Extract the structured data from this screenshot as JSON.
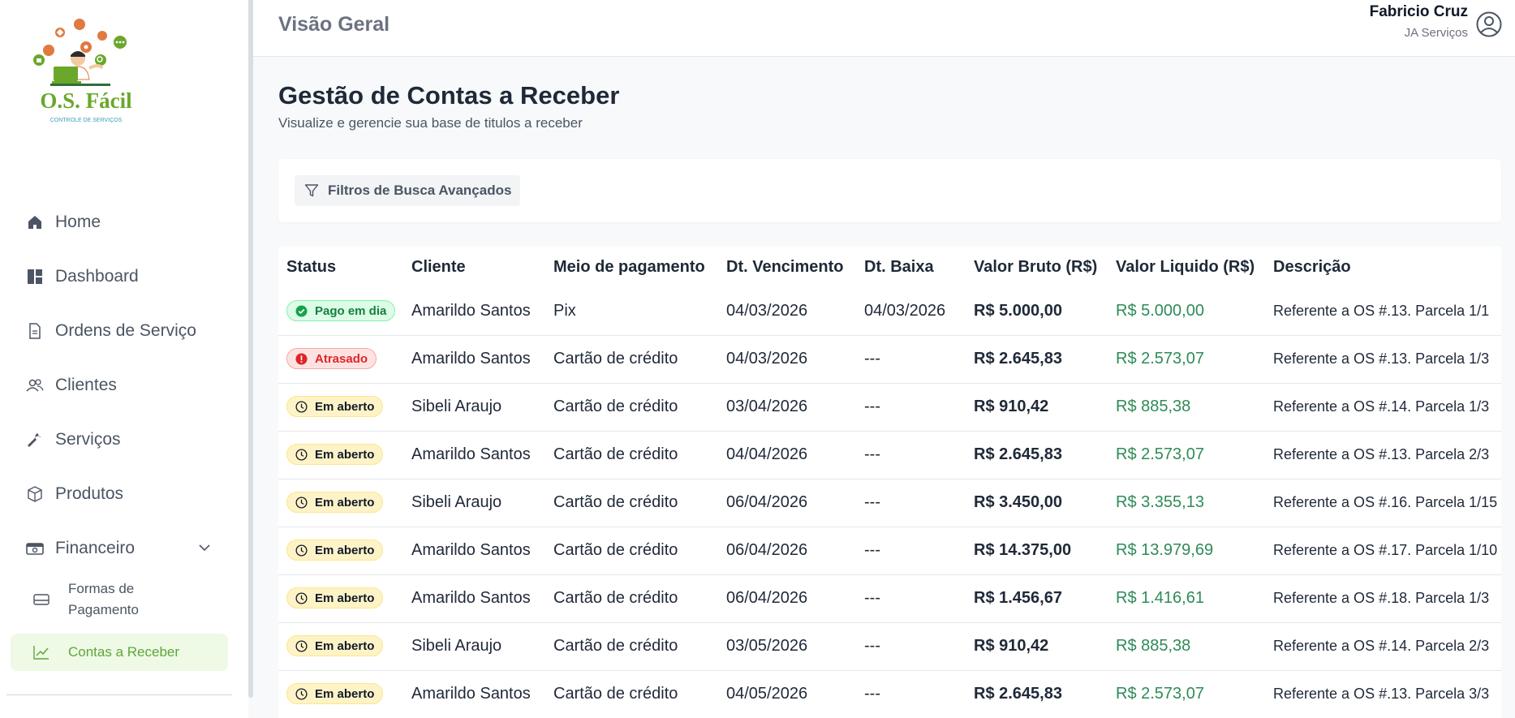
{
  "brand": {
    "logo_text": "O.S. Fácil",
    "logo_tagline": "CONTROLE DE SERVIÇOS",
    "colors": {
      "logo_green": "#6aa72b",
      "logo_orange": "#e07a3f"
    }
  },
  "header": {
    "title": "Visão Geral",
    "user_name": "Fabricio Cruz",
    "user_company": "JA Serviços"
  },
  "sidebar": {
    "items": [
      {
        "label": "Home",
        "icon": "home-icon"
      },
      {
        "label": "Dashboard",
        "icon": "dashboard-icon"
      },
      {
        "label": "Ordens de Serviço",
        "icon": "document-icon"
      },
      {
        "label": "Clientes",
        "icon": "users-icon"
      },
      {
        "label": "Serviços",
        "icon": "wrench-icon"
      },
      {
        "label": "Produtos",
        "icon": "box-icon"
      },
      {
        "label": "Financeiro",
        "icon": "wallet-icon"
      }
    ],
    "subitems": [
      {
        "label": "Formas de Pagamento",
        "icon": "credit-card-icon"
      },
      {
        "label": "Contas a Receber",
        "icon": "trend-up-icon",
        "active": true
      }
    ]
  },
  "main": {
    "title": "Gestão de Contas a Receber",
    "subtitle": "Visualize e gerencie sua base de titulos a receber",
    "filter_label": "Filtros de Busca Avançados"
  },
  "table": {
    "columns": [
      "Status",
      "Cliente",
      "Meio de pagamento",
      "Dt. Vencimento",
      "Dt. Baixa",
      "Valor Bruto (R$)",
      "Valor Liquido (R$)",
      "Descrição"
    ],
    "rows": [
      {
        "status": "Pago em dia",
        "status_type": "paid",
        "cliente": "Amarildo Santos",
        "meio": "Pix",
        "venc": "04/03/2026",
        "baixa": "04/03/2026",
        "bruto": "R$ 5.000,00",
        "liquido": "R$ 5.000,00",
        "desc": "Referente a OS #.13. Parcela 1/1"
      },
      {
        "status": "Atrasado",
        "status_type": "late",
        "cliente": "Amarildo Santos",
        "meio": "Cartão de crédito",
        "venc": "04/03/2026",
        "baixa": "---",
        "bruto": "R$ 2.645,83",
        "liquido": "R$ 2.573,07",
        "desc": "Referente a OS #.13. Parcela 1/3"
      },
      {
        "status": "Em aberto",
        "status_type": "open",
        "cliente": "Sibeli Araujo",
        "meio": "Cartão de crédito",
        "venc": "03/04/2026",
        "baixa": "---",
        "bruto": "R$ 910,42",
        "liquido": "R$ 885,38",
        "desc": "Referente a OS #.14. Parcela 1/3"
      },
      {
        "status": "Em aberto",
        "status_type": "open",
        "cliente": "Amarildo Santos",
        "meio": "Cartão de crédito",
        "venc": "04/04/2026",
        "baixa": "---",
        "bruto": "R$ 2.645,83",
        "liquido": "R$ 2.573,07",
        "desc": "Referente a OS #.13. Parcela 2/3"
      },
      {
        "status": "Em aberto",
        "status_type": "open",
        "cliente": "Sibeli Araujo",
        "meio": "Cartão de crédito",
        "venc": "06/04/2026",
        "baixa": "---",
        "bruto": "R$ 3.450,00",
        "liquido": "R$ 3.355,13",
        "desc": "Referente a OS #.16. Parcela 1/15"
      },
      {
        "status": "Em aberto",
        "status_type": "open",
        "cliente": "Amarildo Santos",
        "meio": "Cartão de crédito",
        "venc": "06/04/2026",
        "baixa": "---",
        "bruto": "R$ 14.375,00",
        "liquido": "R$ 13.979,69",
        "desc": "Referente a OS #.17. Parcela 1/10"
      },
      {
        "status": "Em aberto",
        "status_type": "open",
        "cliente": "Amarildo Santos",
        "meio": "Cartão de crédito",
        "venc": "06/04/2026",
        "baixa": "---",
        "bruto": "R$ 1.456,67",
        "liquido": "R$ 1.416,61",
        "desc": "Referente a OS #.18. Parcela 1/3"
      },
      {
        "status": "Em aberto",
        "status_type": "open",
        "cliente": "Sibeli Araujo",
        "meio": "Cartão de crédito",
        "venc": "03/05/2026",
        "baixa": "---",
        "bruto": "R$ 910,42",
        "liquido": "R$ 885,38",
        "desc": "Referente a OS #.14. Parcela 2/3"
      },
      {
        "status": "Em aberto",
        "status_type": "open",
        "cliente": "Amarildo Santos",
        "meio": "Cartão de crédito",
        "venc": "04/05/2026",
        "baixa": "---",
        "bruto": "R$ 2.645,83",
        "liquido": "R$ 2.573,07",
        "desc": "Referente a OS #.13. Parcela 3/3"
      }
    ]
  }
}
